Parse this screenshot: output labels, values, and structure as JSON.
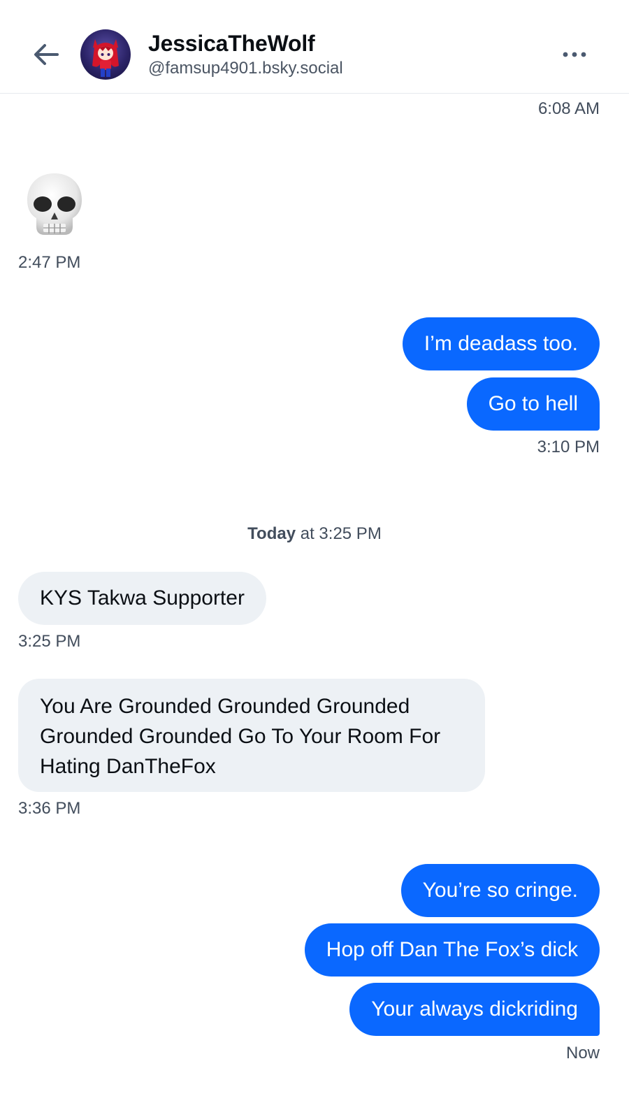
{
  "header": {
    "display_name": "JessicaTheWolf",
    "handle": "@famsup4901.bsky.social"
  },
  "conversation": {
    "top_timestamp": "6:08 AM",
    "skull_emoji": "💀",
    "skull_timestamp": "2:47 PM",
    "group1": {
      "messages": [
        "I’m deadass too.",
        "Go to hell"
      ],
      "timestamp": "3:10 PM"
    },
    "day_separator": {
      "day": "Today",
      "rest": " at 3:25 PM"
    },
    "incoming1": {
      "text": "KYS Takwa Supporter",
      "timestamp": "3:25 PM"
    },
    "incoming2": {
      "text": "You Are Grounded Grounded Grounded Grounded Grounded Go To Your Room For Hating DanTheFox",
      "timestamp": "3:36 PM"
    },
    "group2": {
      "messages": [
        "You’re so cringe.",
        "Hop off Dan The Fox’s dick",
        "Your always dickriding"
      ],
      "timestamp": "Now"
    }
  },
  "colors": {
    "outgoing_bubble": "#0a68ff",
    "incoming_bubble": "#edf1f5",
    "timestamp_text": "#424d5c"
  }
}
